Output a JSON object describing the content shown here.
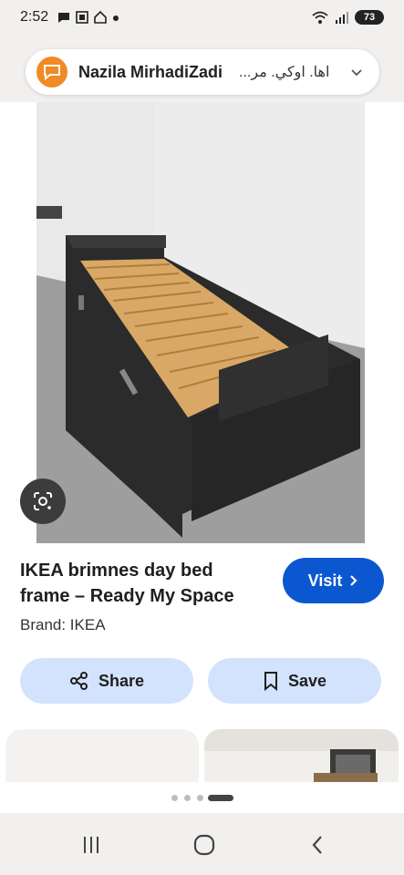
{
  "status_bar": {
    "time": "2:52",
    "battery": "73",
    "icons_left": [
      "chat-bubble-icon",
      "screenshot-icon",
      "home-badge-icon",
      "dot-icon"
    ],
    "icons_right": [
      "wifi-6e-icon",
      "signal-icon",
      "battery-icon"
    ]
  },
  "notification": {
    "sender": "Nazila MirhadiZadi",
    "message": "اها. اوكي. مر...",
    "icon": "messages-app-icon"
  },
  "product": {
    "title": "IKEA brimnes day bed frame – Ready My Space",
    "brand": "Brand: IKEA",
    "visit_label": "Visit",
    "share_label": "Share",
    "save_label": "Save"
  },
  "colors": {
    "accent": "#0b57d0",
    "pill_bg": "#d3e3fd",
    "notif_icon": "#f08a24"
  },
  "pager": {
    "count": 4,
    "active_index": 3
  },
  "nav": {
    "items": [
      "recents-icon",
      "home-icon",
      "back-icon"
    ]
  }
}
